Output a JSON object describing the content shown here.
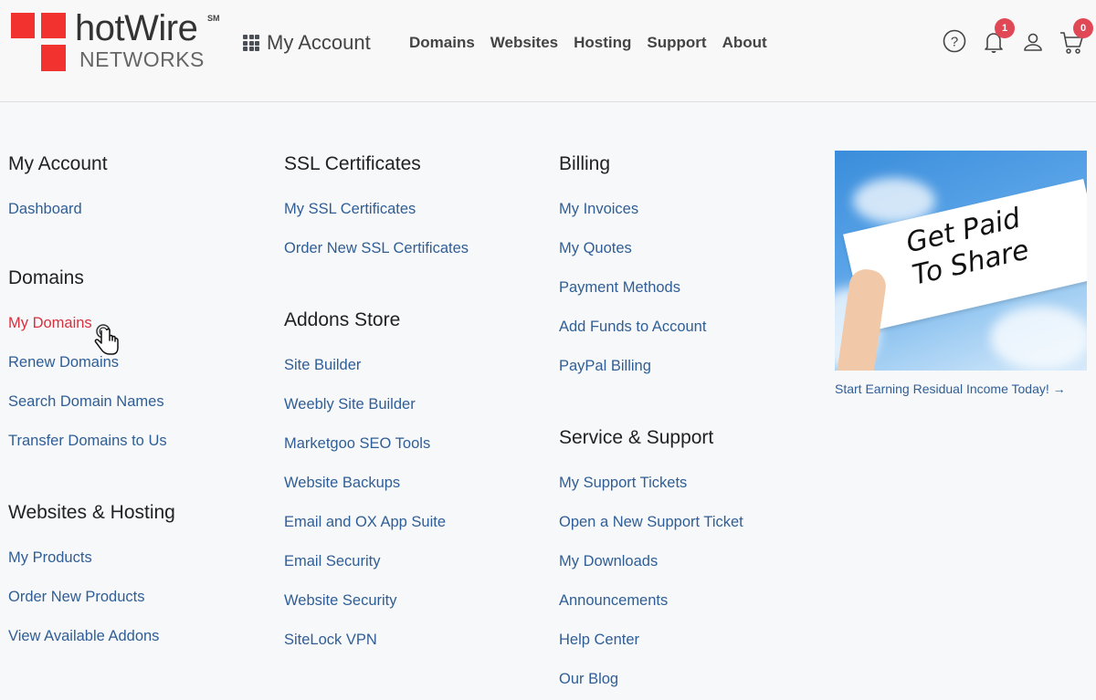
{
  "logo": {
    "brand": "hotWire",
    "mark": "SM",
    "sub": "NETWORKS"
  },
  "header": {
    "my_account_label": "My Account",
    "nav": [
      "Domains",
      "Websites",
      "Hosting",
      "Support",
      "About"
    ],
    "icons": {
      "help": "help-circle-icon",
      "notifications": "bell-icon",
      "account": "user-icon",
      "cart": "cart-icon"
    },
    "notifications_count": "1",
    "cart_count": "0"
  },
  "menu": {
    "col1": [
      {
        "title": "My Account",
        "links": [
          "Dashboard"
        ]
      },
      {
        "title": "Domains",
        "links": [
          "My Domains",
          "Renew Domains",
          "Search Domain Names",
          "Transfer Domains to Us"
        ]
      },
      {
        "title": "Websites & Hosting",
        "links": [
          "My Products",
          "Order New Products",
          "View Available Addons"
        ]
      }
    ],
    "col2": [
      {
        "title": "SSL Certificates",
        "links": [
          "My SSL Certificates",
          "Order New SSL Certificates"
        ]
      },
      {
        "title": "Addons Store",
        "links": [
          "Site Builder",
          "Weebly Site Builder",
          "Marketgoo SEO Tools",
          "Website Backups",
          "Email and OX App Suite",
          "Email Security",
          "Website Security",
          "SiteLock VPN"
        ]
      }
    ],
    "col3": [
      {
        "title": "Billing",
        "links": [
          "My Invoices",
          "My Quotes",
          "Payment Methods",
          "Add Funds to Account",
          "PayPal Billing"
        ]
      },
      {
        "title": "Service & Support",
        "links": [
          "My Support Tickets",
          "Open a New Support Ticket",
          "My Downloads",
          "Announcements",
          "Help Center",
          "Our Blog"
        ]
      }
    ],
    "active_link": "My Domains"
  },
  "promo": {
    "sign_line1": "Get Paid",
    "sign_line2": "To Share",
    "link_text": "Start Earning Residual Income Today! →"
  },
  "colors": {
    "link": "#2f5e96",
    "active_link": "#d9303c",
    "brand_red": "#f2322f",
    "badge": "#e04856"
  }
}
